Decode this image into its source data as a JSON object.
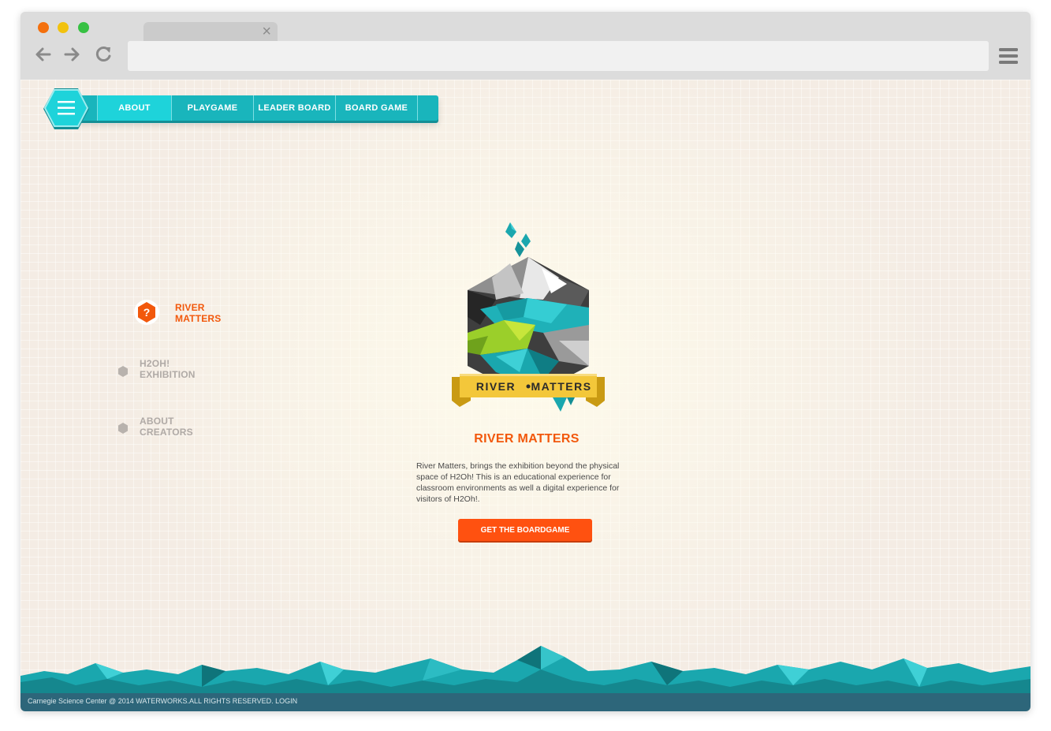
{
  "browser": {
    "tab_close_glyph": "×",
    "address_value": ""
  },
  "topnav": {
    "items": [
      {
        "label": "ABOUT",
        "active": true
      },
      {
        "label": "PLAYGAME",
        "active": false
      },
      {
        "label": "LEADER BOARD",
        "active": false
      },
      {
        "label": "BOARD GAME",
        "active": false
      }
    ]
  },
  "sidenav": {
    "items": [
      {
        "line1": "RIVER",
        "line2": "MATTERS",
        "active": true,
        "icon": "question-hex-icon",
        "icon_glyph": "?"
      },
      {
        "line1": "H2OH!",
        "line2": "EXHIBITION",
        "active": false,
        "icon": "hexagon-bullet-icon"
      },
      {
        "line1": "ABOUT",
        "line2": "CREATORS",
        "active": false,
        "icon": "hexagon-bullet-icon"
      }
    ]
  },
  "main": {
    "logo_text_left": "RIVER",
    "logo_text_right": "MATTERS",
    "title": "RIVER MATTERS",
    "description": "River Matters, brings the exhibition beyond the physical space of H2Oh! This is an educational experience for classroom environments as well a digital experience for visitors of H2Oh!.",
    "cta_label": "GET THE BOARDGAME"
  },
  "footer": {
    "text": "Carnegie Science Center @ 2014 WATERWORKS.ALL RIGHTS RESERVED. LOGIN"
  },
  "colors": {
    "accent_orange": "#f2580c",
    "teal": "#19b5bc",
    "footer_bg": "#2d667a"
  }
}
